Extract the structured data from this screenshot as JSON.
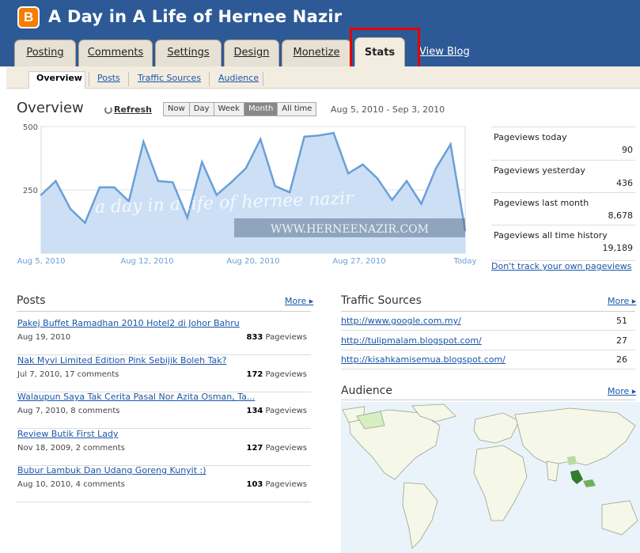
{
  "app": {
    "blog_title": "A Day in A Life of Hernee Nazir",
    "logo_letter": "B"
  },
  "tabs": [
    {
      "label": "Posting"
    },
    {
      "label": "Comments"
    },
    {
      "label": "Settings"
    },
    {
      "label": "Design"
    },
    {
      "label": "Monetize"
    },
    {
      "label": "Stats"
    }
  ],
  "view_blog": "View Blog",
  "subtabs": [
    {
      "label": "Overview"
    },
    {
      "label": "Posts"
    },
    {
      "label": "Traffic Sources"
    },
    {
      "label": "Audience"
    }
  ],
  "overview": {
    "title": "Overview",
    "refresh": "Refresh",
    "ranges": [
      "Now",
      "Day",
      "Week",
      "Month",
      "All time"
    ],
    "selected_range": "Month",
    "date_range": "Aug 5, 2010 - Sep 3, 2010"
  },
  "chart_data": {
    "type": "area",
    "y_ticks": [
      "500",
      "250"
    ],
    "ylim": [
      0,
      500
    ],
    "x_labels": [
      "Aug 5, 2010",
      "Aug 12, 2010",
      "Aug 20, 2010",
      "Aug 27, 2010",
      "Today"
    ],
    "values": [
      230,
      285,
      175,
      120,
      260,
      260,
      205,
      440,
      285,
      280,
      140,
      360,
      230,
      280,
      335,
      450,
      265,
      240,
      460,
      465,
      475,
      315,
      350,
      295,
      210,
      285,
      195,
      335,
      430,
      90
    ],
    "watermark_text": "a day in a life of hernee nazir",
    "watermark_url": "WWW.HERNEENAZIR.COM"
  },
  "stats": [
    {
      "label": "Pageviews today",
      "value": "90"
    },
    {
      "label": "Pageviews yesterday",
      "value": "436"
    },
    {
      "label": "Pageviews last month",
      "value": "8,678"
    },
    {
      "label": "Pageviews all time history",
      "value": "19,189"
    }
  ],
  "dont_track": "Don't track your own pageviews",
  "posts": {
    "title": "Posts",
    "more": "More ▸",
    "pageviews_word": "Pageviews",
    "items": [
      {
        "title": "Pakej Buffet Ramadhan 2010 Hotel2 di Johor Bahru",
        "meta": "Aug 19, 2010",
        "count": "833"
      },
      {
        "title": "Nak Myvi Limited Edition Pink Sebijik Boleh Tak?",
        "meta": "Jul 7, 2010, 17 comments",
        "count": "172"
      },
      {
        "title": "Walaupun Saya Tak Cerita Pasal Nor Azita Osman, Ta...",
        "meta": "Aug 7, 2010, 8 comments",
        "count": "134"
      },
      {
        "title": "Review Butik First Lady",
        "meta": "Nov 18, 2009, 2 comments",
        "count": "127"
      },
      {
        "title": "Bubur Lambuk Dan Udang Goreng Kunyit :)",
        "meta": "Aug 10, 2010, 4 comments",
        "count": "103"
      }
    ]
  },
  "traffic": {
    "title": "Traffic Sources",
    "more": "More ▸",
    "items": [
      {
        "url": "http://www.google.com.my/",
        "count": "51"
      },
      {
        "url": "http://tulipmalam.blogspot.com/",
        "count": "27"
      },
      {
        "url": "http://kisahkamisemua.blogspot.com/",
        "count": "26"
      }
    ]
  },
  "audience": {
    "title": "Audience",
    "more": "More ▸"
  },
  "colors": {
    "header": "#2d5a96",
    "accent_link": "#1a56a8",
    "chart_fill": "#c6dbf4",
    "chart_line": "#6a9fd8",
    "highlight": "#e60000",
    "map_country": "#f5f7e8",
    "map_highlight": "#2f7d2f"
  }
}
